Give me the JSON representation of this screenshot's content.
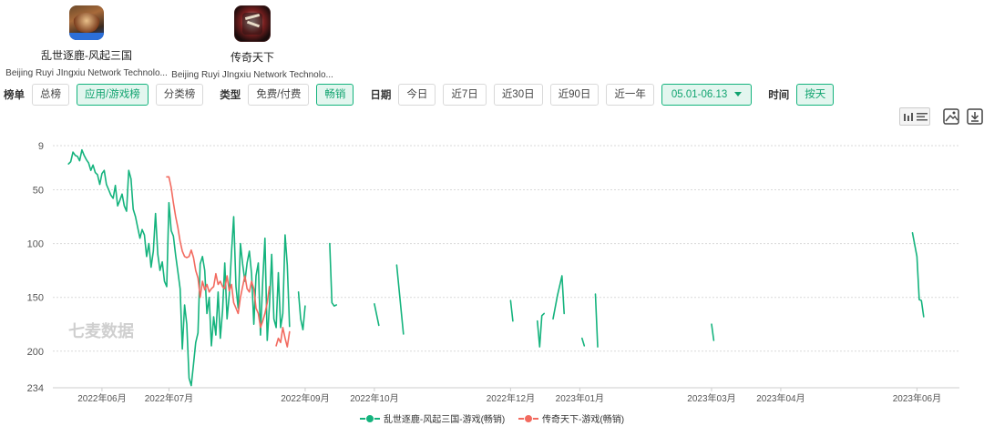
{
  "apps": [
    {
      "name": "乱世逐鹿-风起三国",
      "developer": "Beijing Ruyi JIngxiu Network Technolo..."
    },
    {
      "name": "传奇天下",
      "developer": "Beijing Ruyi JIngxiu Network Technolo..."
    }
  ],
  "filters": {
    "rank_label": "榜单",
    "rank_options": [
      "总榜",
      "应用/游戏榜",
      "分类榜"
    ],
    "rank_selected": 1,
    "type_label": "类型",
    "type_options": [
      "免费/付费",
      "畅销"
    ],
    "type_selected": 1,
    "date_label": "日期",
    "date_options": [
      "今日",
      "近7日",
      "近30日",
      "近90日",
      "近一年"
    ],
    "date_range": "05.01-06.13",
    "time_label": "时间",
    "time_option": "按天"
  },
  "watermark": "七麦数据",
  "colors": {
    "series1": "#14b37d",
    "series2": "#f26a5f",
    "accent": "#10a36f"
  },
  "icons": [
    "bar-chart-icon",
    "list-icon",
    "image-icon",
    "download-icon"
  ],
  "chart_data": {
    "type": "line",
    "y_inverted": true,
    "ylim": [
      9,
      234
    ],
    "yticks": [
      "9",
      "50",
      "100",
      "150",
      "200",
      "234"
    ],
    "x_range": [
      "2022-05-10",
      "2023-06-20"
    ],
    "xticks": [
      {
        "date": "2022-06-01",
        "label": "2022年06月"
      },
      {
        "date": "2022-07-01",
        "label": "2022年07月"
      },
      {
        "date": "2022-08-31",
        "label": "2022年09月"
      },
      {
        "date": "2022-10-01",
        "label": "2022年10月"
      },
      {
        "date": "2022-12-01",
        "label": "2022年12月"
      },
      {
        "date": "2023-01-01",
        "label": "2023年01月"
      },
      {
        "date": "2023-03-01",
        "label": "2023年03月"
      },
      {
        "date": "2023-04-01",
        "label": "2023年04月"
      },
      {
        "date": "2023-06-01",
        "label": "2023年06月"
      }
    ],
    "grid": true,
    "legend_position": "bottom",
    "series": [
      {
        "name": "乱世逐鹿-风起三国-游戏(畅销)",
        "segments": [
          [
            [
              "2022-05-17",
              26
            ],
            [
              "2022-05-18",
              24
            ],
            [
              "2022-05-19",
              15
            ],
            [
              "2022-05-20",
              18
            ],
            [
              "2022-05-21",
              19
            ],
            [
              "2022-05-22",
              23
            ],
            [
              "2022-05-23",
              13
            ],
            [
              "2022-05-24",
              18
            ],
            [
              "2022-05-25",
              22
            ],
            [
              "2022-05-26",
              25
            ],
            [
              "2022-05-27",
              32
            ],
            [
              "2022-05-28",
              27
            ],
            [
              "2022-05-29",
              34
            ],
            [
              "2022-05-30",
              36
            ],
            [
              "2022-05-31",
              45
            ],
            [
              "2022-06-01",
              35
            ],
            [
              "2022-06-02",
              32
            ],
            [
              "2022-06-03",
              45
            ],
            [
              "2022-06-04",
              50
            ],
            [
              "2022-06-05",
              55
            ],
            [
              "2022-06-06",
              58
            ],
            [
              "2022-06-07",
              46
            ],
            [
              "2022-06-08",
              65
            ],
            [
              "2022-06-09",
              60
            ],
            [
              "2022-06-10",
              54
            ],
            [
              "2022-06-11",
              65
            ],
            [
              "2022-06-12",
              70
            ],
            [
              "2022-06-13",
              32
            ],
            [
              "2022-06-14",
              40
            ],
            [
              "2022-06-15",
              68
            ],
            [
              "2022-06-16",
              75
            ],
            [
              "2022-06-17",
              85
            ],
            [
              "2022-06-18",
              95
            ],
            [
              "2022-06-19",
              87
            ],
            [
              "2022-06-20",
              92
            ],
            [
              "2022-06-21",
              112
            ],
            [
              "2022-06-22",
              100
            ],
            [
              "2022-06-23",
              122
            ],
            [
              "2022-06-24",
              107
            ],
            [
              "2022-06-25",
              72
            ],
            [
              "2022-06-26",
              110
            ],
            [
              "2022-06-27",
              125
            ],
            [
              "2022-06-28",
              117
            ],
            [
              "2022-06-29",
              135
            ],
            [
              "2022-06-30",
              140
            ],
            [
              "2022-07-01",
              62
            ],
            [
              "2022-07-02",
              88
            ],
            [
              "2022-07-03",
              93
            ],
            [
              "2022-07-04",
              111
            ],
            [
              "2022-07-05",
              126
            ],
            [
              "2022-07-06",
              142
            ],
            [
              "2022-07-07",
              198
            ],
            [
              "2022-07-08",
              157
            ],
            [
              "2022-07-09",
              175
            ],
            [
              "2022-07-10",
              225
            ],
            [
              "2022-07-11",
              232
            ],
            [
              "2022-07-12",
              212
            ],
            [
              "2022-07-13",
              192
            ],
            [
              "2022-07-14",
              183
            ],
            [
              "2022-07-15",
              119
            ],
            [
              "2022-07-16",
              112
            ],
            [
              "2022-07-17",
              125
            ],
            [
              "2022-07-18",
              165
            ],
            [
              "2022-07-19",
              150
            ],
            [
              "2022-07-20",
              195
            ],
            [
              "2022-07-21",
              168
            ],
            [
              "2022-07-22",
              185
            ],
            [
              "2022-07-23",
              145
            ],
            [
              "2022-07-24",
              188
            ],
            [
              "2022-07-25",
              162
            ],
            [
              "2022-07-26",
              118
            ],
            [
              "2022-07-27",
              170
            ],
            [
              "2022-07-28",
              148
            ],
            [
              "2022-07-29",
              108
            ],
            [
              "2022-07-30",
              75
            ],
            [
              "2022-07-31",
              140
            ],
            [
              "2022-08-01",
              160
            ],
            [
              "2022-08-02",
              100
            ],
            [
              "2022-08-03",
              119
            ],
            [
              "2022-08-04",
              135
            ],
            [
              "2022-08-05",
              118
            ],
            [
              "2022-08-06",
              107
            ],
            [
              "2022-08-07",
              128
            ],
            [
              "2022-08-08",
              175
            ],
            [
              "2022-08-09",
              130
            ],
            [
              "2022-08-10",
              118
            ],
            [
              "2022-08-11",
              185
            ],
            [
              "2022-08-12",
              134
            ],
            [
              "2022-08-13",
              95
            ],
            [
              "2022-08-14",
              190
            ],
            [
              "2022-08-15",
              158
            ],
            [
              "2022-08-16",
              110
            ],
            [
              "2022-08-17",
              170
            ],
            [
              "2022-08-18",
              178
            ],
            [
              "2022-08-19",
              127
            ],
            [
              "2022-08-20",
              178
            ],
            [
              "2022-08-21",
              165
            ],
            [
              "2022-08-22",
              92
            ],
            [
              "2022-08-23",
              120
            ],
            [
              "2022-08-24",
              177
            ]
          ],
          [
            [
              "2022-08-28",
              145
            ],
            [
              "2022-08-29",
              170
            ],
            [
              "2022-08-30",
              180
            ],
            [
              "2022-08-31",
              158
            ]
          ],
          [
            [
              "2022-09-11",
              100
            ],
            [
              "2022-09-12",
              155
            ],
            [
              "2022-09-13",
              158
            ],
            [
              "2022-09-14",
              157
            ]
          ],
          [
            [
              "2022-10-01",
              156
            ],
            [
              "2022-10-03",
              176
            ]
          ],
          [
            [
              "2022-10-11",
              120
            ],
            [
              "2022-10-14",
              184
            ]
          ],
          [
            [
              "2022-12-01",
              153
            ],
            [
              "2022-12-02",
              172
            ]
          ],
          [
            [
              "2022-12-13",
              172
            ],
            [
              "2022-12-14",
              196
            ],
            [
              "2022-12-15",
              167
            ],
            [
              "2022-12-16",
              165
            ]
          ],
          [
            [
              "2022-12-20",
              170
            ],
            [
              "2022-12-22",
              148
            ],
            [
              "2022-12-24",
              130
            ],
            [
              "2022-12-25",
              165
            ]
          ],
          [
            [
              "2023-01-02",
              188
            ],
            [
              "2023-01-03",
              195
            ]
          ],
          [
            [
              "2023-01-08",
              147
            ],
            [
              "2023-01-09",
              196
            ]
          ],
          [
            [
              "2023-03-01",
              175
            ],
            [
              "2023-03-02",
              190
            ]
          ],
          [
            [
              "2023-05-30",
              90
            ],
            [
              "2023-06-01",
              112
            ],
            [
              "2023-06-02",
              152
            ],
            [
              "2023-06-03",
              153
            ],
            [
              "2023-06-04",
              168
            ]
          ]
        ]
      },
      {
        "name": "传奇天下-游戏(畅销)",
        "segments": [
          [
            [
              "2022-06-30",
              38
            ],
            [
              "2022-07-01",
              38
            ],
            [
              "2022-07-02",
              48
            ],
            [
              "2022-07-03",
              62
            ],
            [
              "2022-07-04",
              75
            ],
            [
              "2022-07-05",
              85
            ],
            [
              "2022-07-06",
              98
            ],
            [
              "2022-07-07",
              107
            ],
            [
              "2022-07-08",
              112
            ],
            [
              "2022-07-09",
              113
            ],
            [
              "2022-07-10",
              112
            ],
            [
              "2022-07-11",
              106
            ],
            [
              "2022-07-12",
              113
            ],
            [
              "2022-07-13",
              125
            ],
            [
              "2022-07-14",
              132
            ],
            [
              "2022-07-15",
              150
            ],
            [
              "2022-07-16",
              135
            ],
            [
              "2022-07-17",
              143
            ],
            [
              "2022-07-18",
              138
            ],
            [
              "2022-07-19",
              145
            ],
            [
              "2022-07-20",
              142
            ],
            [
              "2022-07-21",
              140
            ],
            [
              "2022-07-22",
              128
            ],
            [
              "2022-07-23",
              138
            ],
            [
              "2022-07-24",
              135
            ],
            [
              "2022-07-25",
              140
            ],
            [
              "2022-07-26",
              142
            ],
            [
              "2022-07-27",
              130
            ],
            [
              "2022-07-28",
              144
            ],
            [
              "2022-07-29",
              138
            ],
            [
              "2022-07-30",
              155
            ],
            [
              "2022-07-31",
              160
            ],
            [
              "2022-08-01",
              165
            ],
            [
              "2022-08-02",
              150
            ],
            [
              "2022-08-03",
              140
            ],
            [
              "2022-08-04",
              130
            ],
            [
              "2022-08-05",
              142
            ],
            [
              "2022-08-06",
              145
            ],
            [
              "2022-08-07",
              135
            ],
            [
              "2022-08-08",
              142
            ],
            [
              "2022-08-09",
              160
            ],
            [
              "2022-08-10",
              165
            ],
            [
              "2022-08-11",
              178
            ],
            [
              "2022-08-12",
              172
            ],
            [
              "2022-08-13",
              165
            ],
            [
              "2022-08-14",
              155
            ],
            [
              "2022-08-15",
              140
            ]
          ],
          [
            [
              "2022-08-18",
              195
            ],
            [
              "2022-08-19",
              188
            ],
            [
              "2022-08-20",
              192
            ],
            [
              "2022-08-21",
              178
            ],
            [
              "2022-08-22",
              188
            ],
            [
              "2022-08-23",
              196
            ],
            [
              "2022-08-24",
              182
            ]
          ]
        ]
      }
    ]
  }
}
